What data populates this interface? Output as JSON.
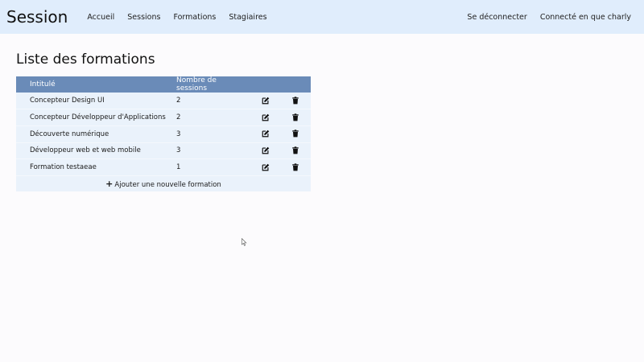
{
  "header": {
    "brand": "Session",
    "nav": [
      "Accueil",
      "Sessions",
      "Formations",
      "Stagiaires"
    ],
    "logout": "Se déconnecter",
    "user": "Connecté en que charly"
  },
  "main": {
    "title": "Liste des formations",
    "table": {
      "columns": [
        "Intitulé",
        "Nombre de sessions"
      ],
      "rows": [
        {
          "name": "Concepteur Design UI",
          "count": "2"
        },
        {
          "name": "Concepteur Développeur d'Applications",
          "count": "2"
        },
        {
          "name": "Découverte numérique",
          "count": "3"
        },
        {
          "name": "Développeur web et web mobile",
          "count": "3"
        },
        {
          "name": "Formation testaeae",
          "count": "1"
        }
      ]
    },
    "add_label": "Ajouter une nouvelle formation"
  },
  "icons": {
    "edit": "edit-icon",
    "delete": "trash-icon",
    "add": "plus-icon"
  },
  "colors": {
    "header_bg": "#e0edfc",
    "table_head": "#6a8bb8",
    "table_body": "#eaf2fb"
  }
}
